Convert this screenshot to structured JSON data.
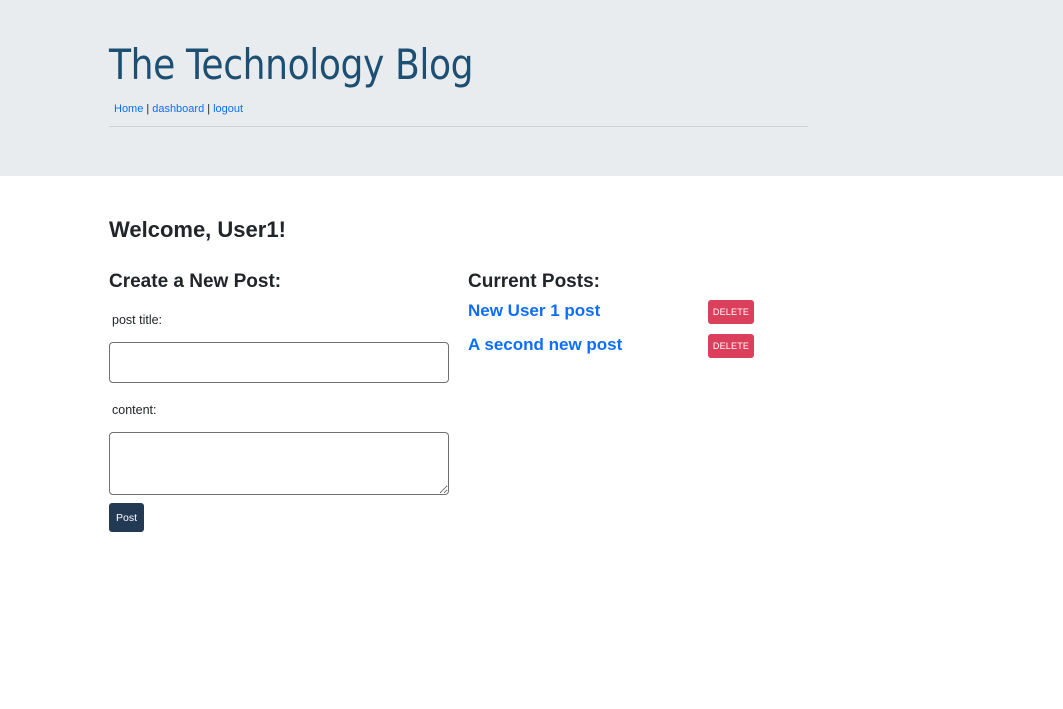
{
  "header": {
    "title": "The Technology Blog",
    "nav": {
      "home": "Home",
      "dashboard": "dashboard",
      "logout": "logout",
      "separator": "|"
    }
  },
  "main": {
    "welcome": "Welcome, User1!",
    "create": {
      "heading": "Create a New Post:",
      "title_label": "post title:",
      "title_value": "",
      "content_label": "content:",
      "content_value": "",
      "submit_label": "Post"
    },
    "current": {
      "heading": "Current Posts:",
      "posts": [
        {
          "title": "New User 1 post",
          "delete_label": "DELETE"
        },
        {
          "title": "A second new post",
          "delete_label": "DELETE"
        }
      ]
    }
  },
  "colors": {
    "header_bg": "#e9ecef",
    "title": "#1d4f73",
    "link": "#0d6efd",
    "post_button": "#233a55",
    "delete_button": "#dc3f5c"
  }
}
